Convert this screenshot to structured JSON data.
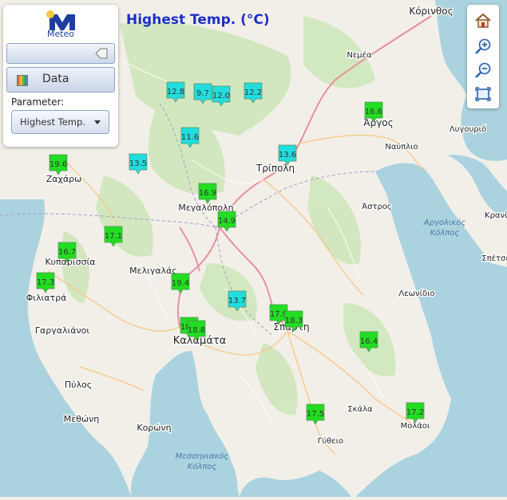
{
  "app": {
    "logo_text": "Meteo",
    "map_title": "Highest Temp. (°C)"
  },
  "sidebar": {
    "data_button_label": "Data",
    "parameter_label": "Parameter:",
    "parameter_value": "Highest Temp."
  },
  "map_controls": {
    "icons": [
      "home-icon",
      "zoom-in-icon",
      "zoom-out-icon",
      "zoom-extent-icon"
    ]
  },
  "place_labels": [
    {
      "name": "Κόρινθος"
    },
    {
      "name": "Νεμέα"
    },
    {
      "name": "Άργος"
    },
    {
      "name": "Ναύπλιο"
    },
    {
      "name": "Λυγουριό"
    },
    {
      "name": "Τρίπολη"
    },
    {
      "name": "Ζαχάρω"
    },
    {
      "name": "Μεγαλόπολη"
    },
    {
      "name": "Άστρος"
    },
    {
      "name": "Αργολικός Κόλπος"
    },
    {
      "name": "Κυπαρισσία"
    },
    {
      "name": "Μελιγαλάς"
    },
    {
      "name": "Φιλιατρά"
    },
    {
      "name": "Λεωνίδιο"
    },
    {
      "name": "Γαργαλιάνοι"
    },
    {
      "name": "Καλαμάτα"
    },
    {
      "name": "Σπάρτη"
    },
    {
      "name": "Πύλος"
    },
    {
      "name": "Μεθώνη"
    },
    {
      "name": "Κορώνη"
    },
    {
      "name": "Σκάλα"
    },
    {
      "name": "Μολάοι"
    },
    {
      "name": "Γύθειο"
    },
    {
      "name": "Μεσσηνιακός Κόλπος"
    },
    {
      "name": "Κρανίδι"
    },
    {
      "name": "Σπέτσες"
    }
  ],
  "stations": [
    {
      "value": "12.8"
    },
    {
      "value": "9.7"
    },
    {
      "value": "12.0"
    },
    {
      "value": "12.2"
    },
    {
      "value": "16.6"
    },
    {
      "value": "11.6"
    },
    {
      "value": "13.6"
    },
    {
      "value": "19.6"
    },
    {
      "value": "13.5"
    },
    {
      "value": "16.9"
    },
    {
      "value": "14.9"
    },
    {
      "value": "17.1"
    },
    {
      "value": "16.7"
    },
    {
      "value": "17.3"
    },
    {
      "value": "19.4"
    },
    {
      "value": "13.7"
    },
    {
      "value": "17.9"
    },
    {
      "value": "18.3"
    },
    {
      "value": "18.6"
    },
    {
      "value": "18.8"
    },
    {
      "value": "16.4"
    },
    {
      "value": "17.5"
    },
    {
      "value": "17.2"
    }
  ],
  "colors": {
    "sea": "#aad3df",
    "land": "#f2efe9",
    "forest": "#c8e3b4",
    "marker_warm": "#22dd22",
    "marker_cool": "#22dddd",
    "title": "#1d2fc6"
  }
}
